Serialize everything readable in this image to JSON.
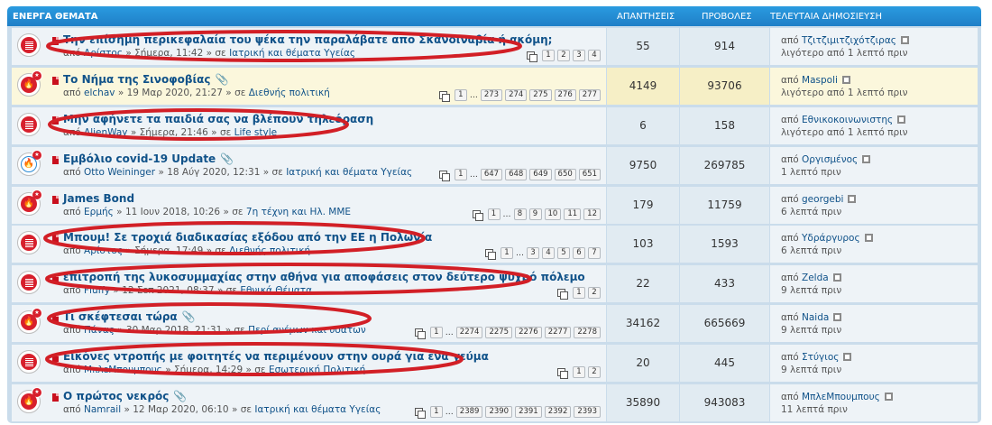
{
  "header": {
    "topics": "ΕΝΕΡΓΑ ΘΕΜΑΤΑ",
    "replies": "ΑΠΑΝΤΗΣΕΙΣ",
    "views": "ΠΡΟΒΟΛΕΣ",
    "last_post": "ΤΕΛΕΥΤΑΙΑ ΔΗΜΟΣΙΕΥΣΗ"
  },
  "colors": {
    "header": "#1f7fc7",
    "link": "#105289",
    "accent_red": "#d71f2c",
    "sticky_bg": "#fbf7dc",
    "annotation": "#d21f26"
  },
  "icons": {
    "topic_hot": "fire-icon",
    "topic_unread": "lines-icon",
    "attachment": "paperclip-icon",
    "pages": "pages-icon",
    "goto": "goto-last-post-icon"
  },
  "topics": [
    {
      "title": "Την επίσημη περικεφαλαία του ψέκα την παραλάβατε απο Σκανδιναβία ή ακόμη;",
      "attachment": false,
      "by": "από",
      "author": "Αρίστος",
      "sep": "»",
      "time": "Σήμερα, 11:42",
      "in": "σε",
      "forum": "Ιατρική και θέματα Υγείας",
      "pages": [
        "1",
        "2",
        "3",
        "4"
      ],
      "replies": "55",
      "views": "914",
      "last_by": "από",
      "last_author": "Τζιτζιμιτζιχότζιρας",
      "last_time": "λιγότερο από 1 λεπτό πριν",
      "icon": "lines"
    },
    {
      "title": "Το Νήμα της Σινοφοβίας",
      "attachment": true,
      "by": "από",
      "author": "elchav",
      "sep": "»",
      "time": "19 Μαρ 2020, 21:27",
      "in": "σε",
      "forum": "Διεθνής πολιτική",
      "pages": [
        "1",
        "…",
        "273",
        "274",
        "275",
        "276",
        "277"
      ],
      "replies": "4149",
      "views": "93706",
      "last_by": "από",
      "last_author": "Maspoli",
      "last_time": "λιγότερο από 1 λεπτό πριν",
      "icon": "flame",
      "sticky": true
    },
    {
      "title": "Μην αφήνετε τα παιδιά σας να βλέπουν τηλεόραση",
      "attachment": false,
      "by": "από",
      "author": "AlienWay",
      "sep": "»",
      "time": "Σήμερα, 21:46",
      "in": "σε",
      "forum": "Life style",
      "pages": [],
      "replies": "6",
      "views": "158",
      "last_by": "από",
      "last_author": "Εθνικοκοινωνιστης",
      "last_time": "λιγότερο από 1 λεπτό πριν",
      "icon": "lines"
    },
    {
      "title": "Εμβόλιο covid-19 Update",
      "attachment": true,
      "by": "από",
      "author": "Otto Weininger",
      "sep": "»",
      "time": "18 Αύγ 2020, 12:31",
      "in": "σε",
      "forum": "Ιατρική και θέματα Υγείας",
      "pages": [
        "1",
        "…",
        "647",
        "648",
        "649",
        "650",
        "651"
      ],
      "replies": "9750",
      "views": "269785",
      "last_by": "από",
      "last_author": "Οργισμένος",
      "last_time": "1 λεπτό πριν",
      "icon": "flame-blue"
    },
    {
      "title": "James Bond",
      "attachment": false,
      "by": "από",
      "author": "Ερμής",
      "sep": "»",
      "time": "11 Ιουν 2018, 10:26",
      "in": "σε",
      "forum": "7η τέχνη και Ηλ. ΜΜΕ",
      "pages": [
        "1",
        "…",
        "8",
        "9",
        "10",
        "11",
        "12"
      ],
      "replies": "179",
      "views": "11759",
      "last_by": "από",
      "last_author": "georgebi",
      "last_time": "6 λεπτά πριν",
      "icon": "flame"
    },
    {
      "title": "Μπουμ! Σε τροχιά διαδικασίας εξόδου από την ΕΕ η Πολωνία",
      "attachment": false,
      "by": "από",
      "author": "Αρίστος",
      "sep": "»",
      "time": "Σήμερα, 17:49",
      "in": "σε",
      "forum": "Διεθνής πολιτική",
      "pages": [
        "1",
        "…",
        "3",
        "4",
        "5",
        "6",
        "7"
      ],
      "replies": "103",
      "views": "1593",
      "last_by": "από",
      "last_author": "Υδράργυρος",
      "last_time": "6 λεπτά πριν",
      "icon": "lines"
    },
    {
      "title": "επιτροπή της λυκοσυμμαχίας στην αθήνα για αποφάσεις στον δεύτερο ψυχρό πόλεμο",
      "attachment": false,
      "by": "από",
      "author": "Fluffy",
      "sep": "»",
      "time": "12 Σεπ 2021, 08:37",
      "in": "σε",
      "forum": "Εθνικά Θέματα",
      "pages": [
        "1",
        "2"
      ],
      "replies": "22",
      "views": "433",
      "last_by": "από",
      "last_author": "Zelda",
      "last_time": "9 λεπτά πριν",
      "icon": "lines"
    },
    {
      "title": "Τι σκέφτεσαι τώρα",
      "attachment": true,
      "by": "από",
      "author": "Πάνας",
      "sep": "»",
      "time": "30 Μαρ 2018, 21:31",
      "in": "σε",
      "forum": "Περί ανέμων και υδάτων",
      "pages": [
        "1",
        "…",
        "2274",
        "2275",
        "2276",
        "2277",
        "2278"
      ],
      "replies": "34162",
      "views": "665669",
      "last_by": "από",
      "last_author": "Naida",
      "last_time": "9 λεπτά πριν",
      "icon": "flame"
    },
    {
      "title": "Εικόνες ντροπής με φοιτητές να περιμένουν στην ουρά για ένα γεύμα",
      "attachment": false,
      "by": "από",
      "author": "ΜπλεΜπουμπους",
      "sep": "»",
      "time": "Σήμερα, 14:29",
      "in": "σε",
      "forum": "Εσωτερική Πολιτική",
      "pages": [
        "1",
        "2"
      ],
      "replies": "20",
      "views": "445",
      "last_by": "από",
      "last_author": "Στύγιος",
      "last_time": "9 λεπτά πριν",
      "icon": "lines"
    },
    {
      "title": "Ο πρώτος νεκρός",
      "attachment": true,
      "by": "από",
      "author": "Namrail",
      "sep": "»",
      "time": "12 Μαρ 2020, 06:10",
      "in": "σε",
      "forum": "Ιατρική και θέματα Υγείας",
      "pages": [
        "1",
        "…",
        "2389",
        "2390",
        "2391",
        "2392",
        "2393"
      ],
      "replies": "35890",
      "views": "943083",
      "last_by": "από",
      "last_author": "ΜπλεΜπουμπους",
      "last_time": "11 λεπτά πριν",
      "icon": "flame"
    }
  ]
}
